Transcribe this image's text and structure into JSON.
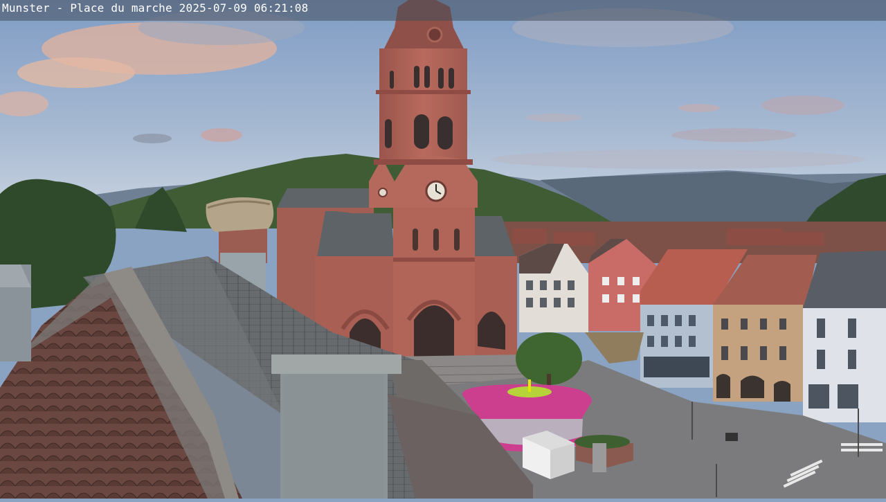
{
  "overlay": {
    "caption": "Munster - Place du marche 2025-07-09 06:21:08"
  },
  "scene": {
    "colors": {
      "sky_top": "#7f9cc4",
      "sky_bottom": "#c9d3e0",
      "cloud_warm": "#e7b49c",
      "mountain_far": "#6f8095",
      "hill_green": "#3d5a34",
      "sandstone": "#b4665a",
      "sandstone_dark": "#8c4a42",
      "roof_slate": "#5f6468",
      "roof_tile": "#6e4a44",
      "kiosk_magenta": "#d0408e",
      "square_gray": "#7a7a7c"
    }
  }
}
